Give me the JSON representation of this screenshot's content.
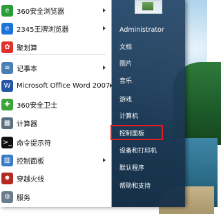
{
  "start_menu": {
    "programs": [
      {
        "name": "360安全浏览器",
        "icon": "360-browser-icon",
        "color": "#2a9d3a",
        "glyph": "e",
        "submenu": true
      },
      {
        "name": "2345王牌浏览器",
        "icon": "2345-browser-icon",
        "color": "#1e73d8",
        "glyph": "e",
        "submenu": true
      },
      {
        "name": "聚划算",
        "icon": "juhuasuan-icon",
        "color": "#e0322c",
        "glyph": "✿",
        "submenu": false
      },
      {
        "name": "记事本",
        "icon": "notepad-icon",
        "color": "#4a7fb5",
        "glyph": "≡",
        "submenu": true
      },
      {
        "name": "Microsoft Office Word 2007",
        "icon": "word-icon",
        "color": "#2456a6",
        "glyph": "W",
        "submenu": true
      },
      {
        "name": "360安全卫士",
        "icon": "360-safe-guard-icon",
        "color": "#3ca43a",
        "glyph": "✚",
        "submenu": false
      },
      {
        "name": "计算器",
        "icon": "calculator-icon",
        "color": "#5a7080",
        "glyph": "▦",
        "submenu": false
      },
      {
        "name": "命令提示符",
        "icon": "command-prompt-icon",
        "color": "#101010",
        "glyph": ">_",
        "submenu": false
      },
      {
        "name": "控制面板",
        "icon": "control-panel-icon",
        "color": "#3a7bc8",
        "glyph": "▥",
        "submenu": true
      },
      {
        "name": "穿越火线",
        "icon": "crossfire-icon",
        "color": "#b22a20",
        "glyph": "✸",
        "submenu": false
      },
      {
        "name": "服务",
        "icon": "services-icon",
        "color": "#6b7d8c",
        "glyph": "⚙",
        "submenu": false
      }
    ],
    "right_items": [
      {
        "name": "Administrator",
        "key": "administrator"
      },
      {
        "name": "文档",
        "key": "documents"
      },
      {
        "name": "图片",
        "key": "pictures"
      },
      {
        "name": "音乐",
        "key": "music"
      },
      {
        "name": "游戏",
        "key": "games"
      },
      {
        "name": "计算机",
        "key": "computer"
      },
      {
        "name": "控制面板",
        "key": "control-panel"
      },
      {
        "name": "设备和打印机",
        "key": "devices-and-printers"
      },
      {
        "name": "默认程序",
        "key": "default-programs"
      },
      {
        "name": "帮助和支持",
        "key": "help-and-support"
      }
    ],
    "highlighted_item": "控制面板"
  }
}
